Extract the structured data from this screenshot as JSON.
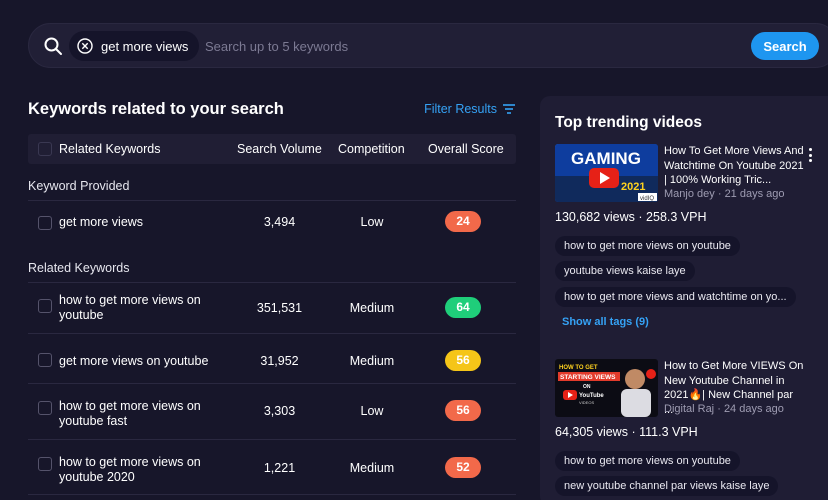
{
  "search": {
    "chip_label": "get more views",
    "placeholder": "Search up to 5 keywords",
    "button_label": "Search"
  },
  "left": {
    "title": "Keywords related to your search",
    "filter_label": "Filter Results",
    "columns": [
      "Related Keywords",
      "Search Volume",
      "Competition",
      "Overall Score"
    ],
    "group_provided": "Keyword Provided",
    "group_related": "Related Keywords",
    "rows": [
      {
        "keyword": "get more views",
        "volume": "3,494",
        "competition": "Low",
        "score": "24",
        "score_color": "#f2694a"
      },
      {
        "keyword": "how to get more views on youtube",
        "volume": "351,531",
        "competition": "Medium",
        "score": "64",
        "score_color": "#1fce7a"
      },
      {
        "keyword": "get more views on youtube",
        "volume": "31,952",
        "competition": "Medium",
        "score": "56",
        "score_color": "#f5c518"
      },
      {
        "keyword": "how to get more views on youtube fast",
        "volume": "3,303",
        "competition": "Low",
        "score": "56",
        "score_color": "#f2694a"
      },
      {
        "keyword": "how to get more views on youtube 2020",
        "volume": "1,221",
        "competition": "Medium",
        "score": "52",
        "score_color": "#f2694a"
      }
    ]
  },
  "right": {
    "title": "Top trending videos",
    "videos": [
      {
        "title": "How To Get More Views And Watchtime On Youtube 2021 | 100% Working Tric...",
        "channel": "Manjo dey",
        "age": "21 days ago",
        "views": "130,682 views",
        "vph": "258.3 VPH",
        "tags": [
          "how to get more views on youtube",
          "youtube views kaise laye",
          "how to get more views and watchtime on yo..."
        ],
        "show_tags": "Show all tags (9)",
        "thumb_text_1": "GAMING",
        "thumb_text_2": "2021",
        "thumb_badge": "vidIQ"
      },
      {
        "title": "How to Get More VIEWS On New Youtube Channel in 2021🔥| New Channel par ...",
        "channel": "Digital Raj",
        "age": "24 days ago",
        "views": "64,305 views",
        "vph": "111.3 VPH",
        "tags": [
          "how to get more views on youtube",
          "new youtube channel par views kaise laye"
        ],
        "thumb_text_1": "HOW TO GET",
        "thumb_text_2": "STARTING VIEWS",
        "thumb_text_3": "ON",
        "thumb_text_4": "YouTube",
        "thumb_text_5": "VIDEOS"
      }
    ]
  },
  "colors": {
    "background": "#17162a",
    "accent": "#1e96f0",
    "panel": "#1f1d34"
  }
}
